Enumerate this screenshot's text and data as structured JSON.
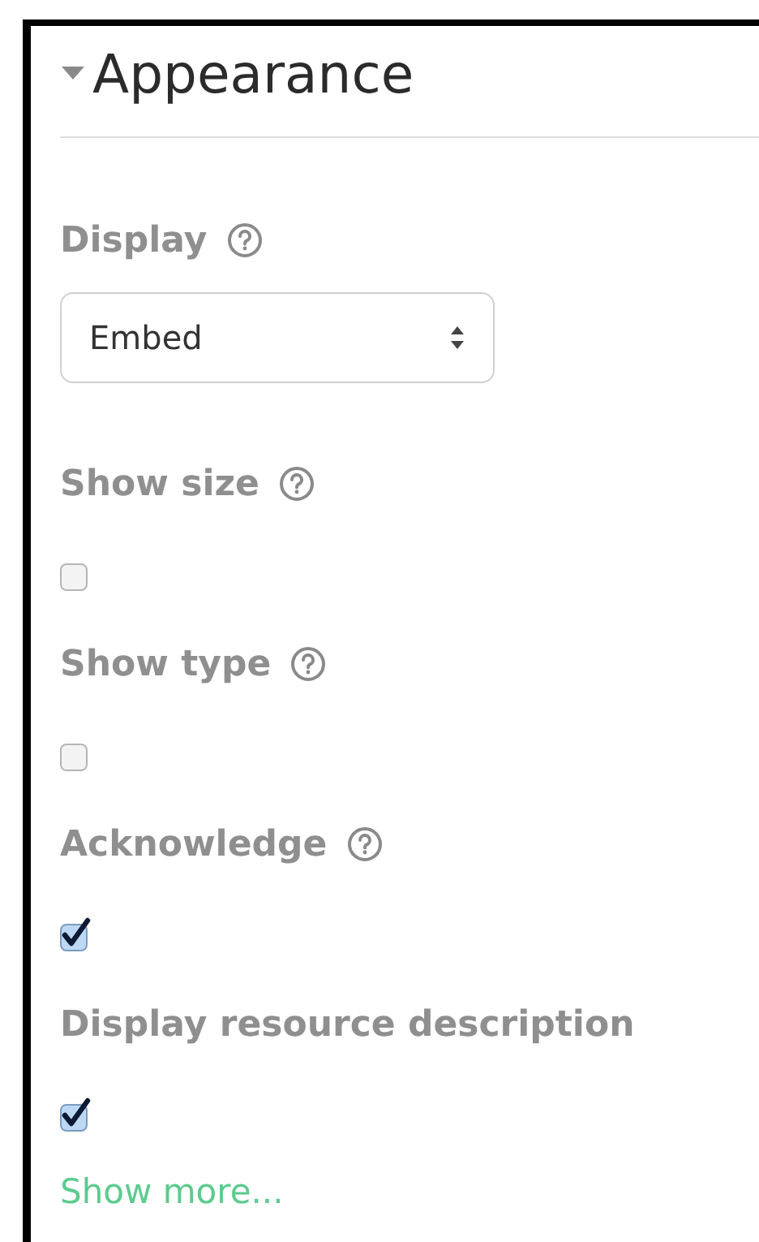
{
  "section": {
    "title": "Appearance",
    "expanded": true
  },
  "fields": [
    {
      "kind": "select",
      "label": "Display",
      "help": true,
      "value": "Embed"
    },
    {
      "kind": "checkbox",
      "label": "Show size",
      "help": true,
      "checked": false
    },
    {
      "kind": "checkbox",
      "label": "Show type",
      "help": true,
      "checked": false
    },
    {
      "kind": "checkbox",
      "label": "Acknowledge",
      "help": true,
      "checked": true
    },
    {
      "kind": "checkbox",
      "label": "Display resource description",
      "help": false,
      "checked": true
    }
  ],
  "show_more": "Show more..."
}
